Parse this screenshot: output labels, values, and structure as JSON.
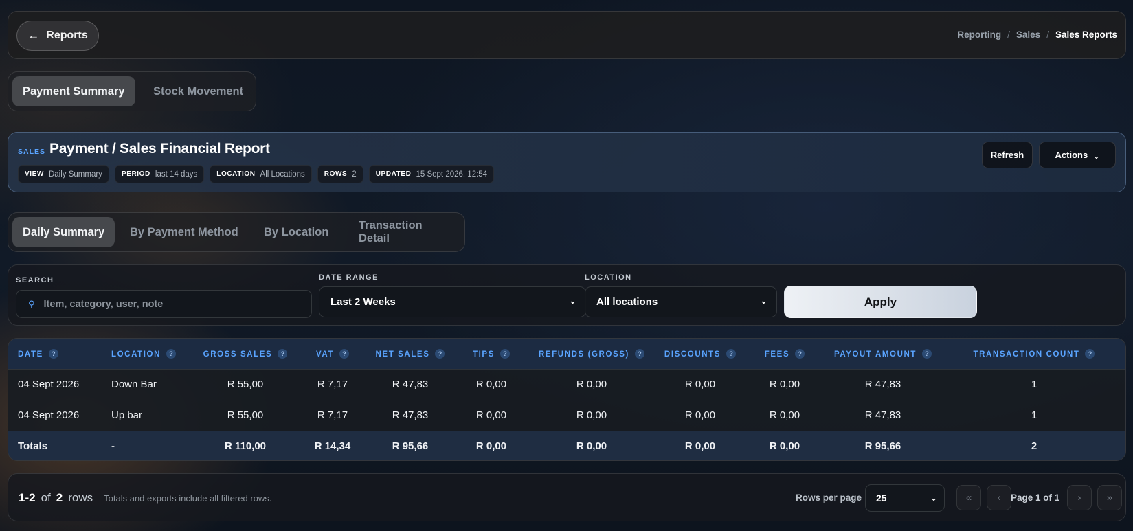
{
  "topbar": {
    "back_label": "Reports",
    "breadcrumb": [
      "Reporting",
      "Sales",
      "Sales Reports"
    ]
  },
  "report_tabs": [
    "Payment Summary",
    "Stock Movement"
  ],
  "header": {
    "kicker": "SALES",
    "title": "Payment / Sales Financial Report",
    "chips": [
      {
        "key": "VIEW",
        "value": "Daily Summary"
      },
      {
        "key": "PERIOD",
        "value": "last 14 days"
      },
      {
        "key": "LOCATION",
        "value": "All Locations"
      },
      {
        "key": "ROWS",
        "value": "2"
      },
      {
        "key": "UPDATED",
        "value": "15 Sept 2026, 12:54"
      }
    ],
    "refresh_label": "Refresh",
    "actions_label": "Actions"
  },
  "view_tabs": [
    "Daily Summary",
    "By Payment Method",
    "By Location",
    "Transaction Detail"
  ],
  "filters": {
    "search_label": "SEARCH",
    "search_placeholder": "Item, category, user, note",
    "date_label": "DATE RANGE",
    "date_value": "Last 2 Weeks",
    "location_label": "LOCATION",
    "location_value": "All locations",
    "apply_label": "Apply"
  },
  "table": {
    "help": "?",
    "columns": [
      "DATE",
      "LOCATION",
      "GROSS SALES",
      "VAT",
      "NET SALES",
      "TIPS",
      "REFUNDS (GROSS)",
      "DISCOUNTS",
      "FEES",
      "PAYOUT AMOUNT",
      "TRANSACTION COUNT"
    ],
    "rows": [
      [
        "04 Sept 2026",
        "Down Bar",
        "R 55,00",
        "R 7,17",
        "R 47,83",
        "R 0,00",
        "R 0,00",
        "R 0,00",
        "R 0,00",
        "R 47,83",
        "1"
      ],
      [
        "04 Sept 2026",
        "Up bar",
        "R 55,00",
        "R 7,17",
        "R 47,83",
        "R 0,00",
        "R 0,00",
        "R 0,00",
        "R 0,00",
        "R 47,83",
        "1"
      ]
    ],
    "totals": [
      "Totals",
      "-",
      "R 110,00",
      "R 14,34",
      "R 95,66",
      "R 0,00",
      "R 0,00",
      "R 0,00",
      "R 0,00",
      "R 95,66",
      "2"
    ]
  },
  "pager": {
    "range": "1-2",
    "of_word": "of",
    "total": "2",
    "rows_word": "rows",
    "note": "Totals and exports include all filtered rows.",
    "rows_per_page_label": "Rows per page",
    "rows_per_page_value": "25",
    "page_info": "Page 1 of 1"
  }
}
